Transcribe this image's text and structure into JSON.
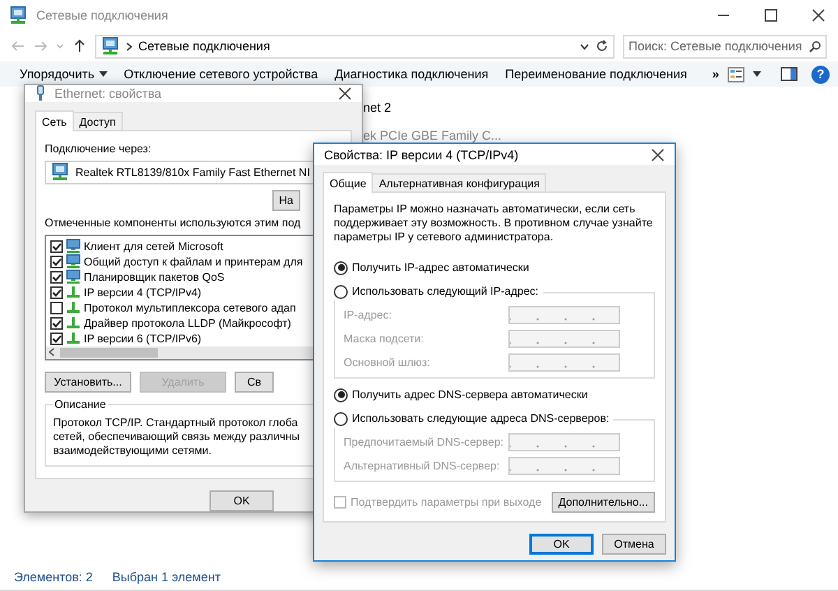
{
  "window": {
    "title": "Сетевые подключения"
  },
  "address_bar": {
    "path": "Сетевые подключения"
  },
  "search": {
    "placeholder": "Поиск: Сетевые подключения"
  },
  "toolbar": {
    "items": [
      {
        "label": "Упорядочить",
        "kind": "menu"
      },
      {
        "label": "Отключение сетевого устройства",
        "kind": "command"
      },
      {
        "label": "Диагностика подключения",
        "kind": "command"
      },
      {
        "label": "Переименование подключения",
        "kind": "command"
      },
      {
        "label": "»",
        "kind": "more"
      }
    ],
    "help": "?"
  },
  "connections": [
    {
      "name": "net 2",
      "device": "ek PCIe GBE Family C..."
    }
  ],
  "status_bar": {
    "count": "Элементов: 2",
    "selection": "Выбран 1 элемент"
  },
  "ethernet_dialog": {
    "title": "Ethernet: свойства",
    "tabs": [
      {
        "label": "Сеть",
        "selected": true
      },
      {
        "label": "Доступ",
        "selected": false
      }
    ],
    "connect_label": "Подключение через:",
    "adapter": "Realtek RTL8139/810x Family Fast Ethernet NI",
    "configure_button": "На",
    "components_label": "Отмеченные компоненты используются этим под",
    "components": [
      {
        "label": "Клиент для сетей Microsoft",
        "checked": true,
        "kind": "client"
      },
      {
        "label": "Общий доступ к файлам и принтерам для",
        "checked": true,
        "kind": "client"
      },
      {
        "label": "Планировщик пакетов QoS",
        "checked": true,
        "kind": "client"
      },
      {
        "label": "IP версии 4 (TCP/IPv4)",
        "checked": true,
        "kind": "protocol"
      },
      {
        "label": "Протокол мультиплексора сетевого адап",
        "checked": false,
        "kind": "protocol"
      },
      {
        "label": "Драйвер протокола LLDP (Майкрософт)",
        "checked": true,
        "kind": "protocol"
      },
      {
        "label": "IP версии 6 (TCP/IPv6)",
        "checked": true,
        "kind": "protocol"
      }
    ],
    "buttons": [
      {
        "label": "Установить...",
        "disabled": false
      },
      {
        "label": "Удалить",
        "disabled": true
      },
      {
        "label": "Св",
        "disabled": false
      }
    ],
    "description": {
      "title": "Описание",
      "lines": [
        "Протокол TCP/IP. Стандартный протокол глоба",
        "сетей, обеспечивающий связь между различны",
        "взаимодействующими сетями."
      ]
    },
    "ok": {
      "label": "OK",
      "default": false
    }
  },
  "ipv4_dialog": {
    "title": "Свойства: IP версии 4 (TCP/IPv4)",
    "tabs": [
      {
        "label": "Общие",
        "selected": true
      },
      {
        "label": "Альтернативная конфигурация",
        "selected": false
      }
    ],
    "intro": "Параметры IP можно назначать автоматически, если сеть поддерживает эту возможность. В противном случае узнайте параметры IP у сетевого администратора.",
    "ip_modes": [
      {
        "label": "Получить IP-адрес автоматически",
        "selected": true
      },
      {
        "label": "Использовать следующий IP-адрес:",
        "selected": false
      }
    ],
    "ip_fields": [
      {
        "label": "IP-адрес:",
        "disabled": true
      },
      {
        "label": "Маска подсети:",
        "disabled": true
      },
      {
        "label": "Основной шлюз:",
        "disabled": true
      }
    ],
    "dns_modes": [
      {
        "label": "Получить адрес DNS-сервера автоматически",
        "selected": true
      },
      {
        "label": "Использовать следующие адреса DNS-серверов:",
        "selected": false
      }
    ],
    "dns_fields": [
      {
        "label": "Предпочитаемый DNS-сервер:",
        "disabled": true
      },
      {
        "label": "Альтернативный DNS-сервер:",
        "disabled": true
      }
    ],
    "confirm": {
      "label": "Подтвердить параметры при выходе",
      "checked": false,
      "disabled": true
    },
    "advanced_button": "Дополнительно...",
    "ok": {
      "label": "OK",
      "default": true
    },
    "cancel": "Отмена"
  }
}
